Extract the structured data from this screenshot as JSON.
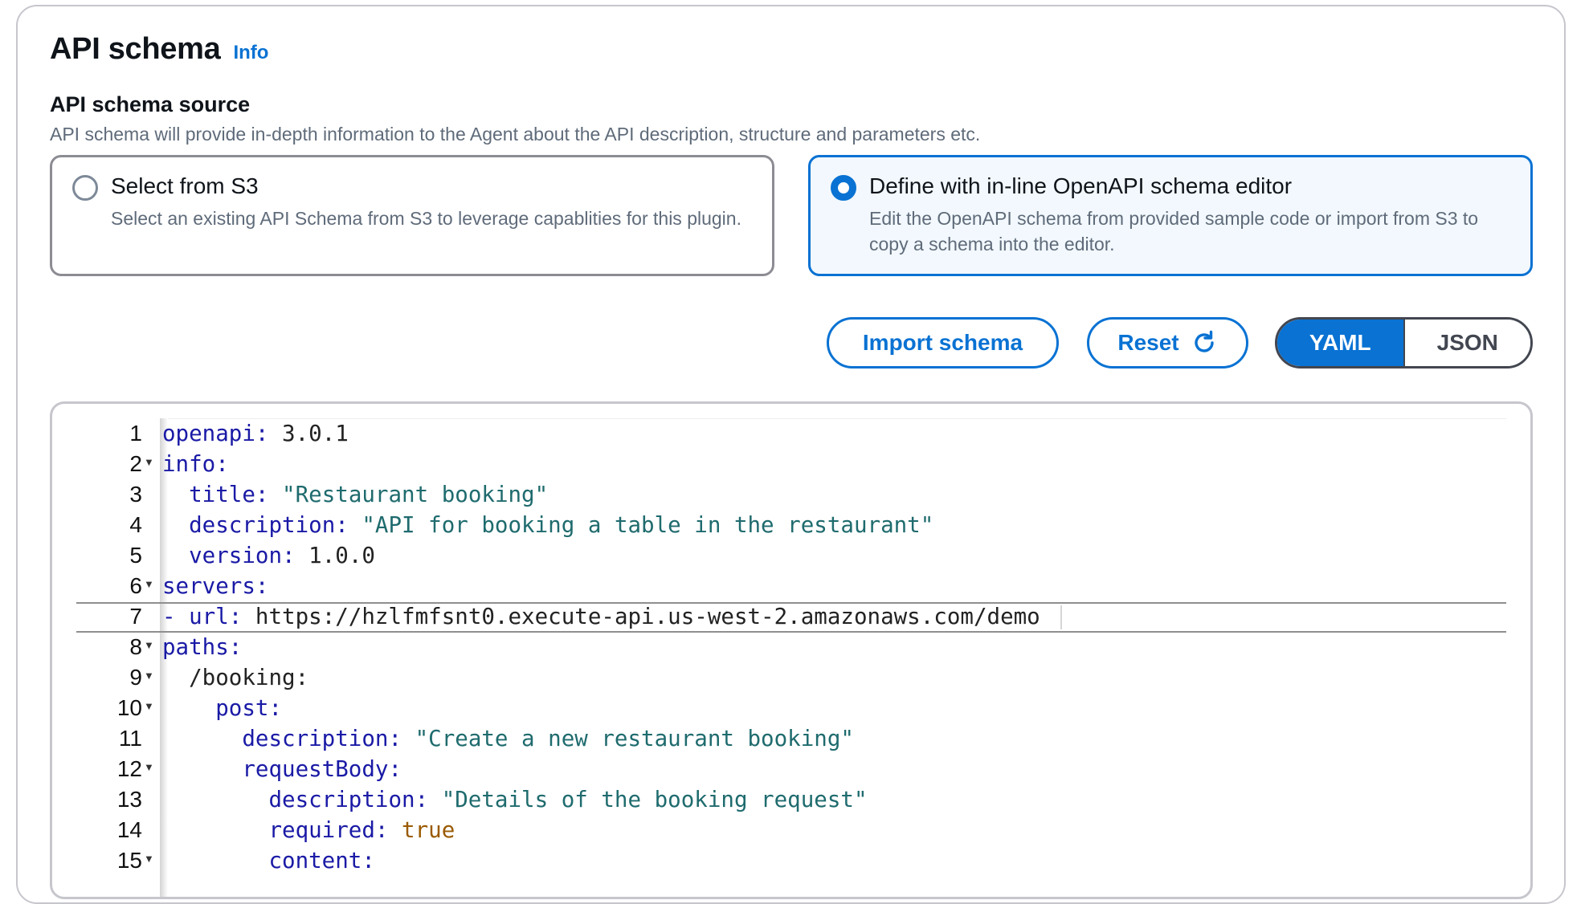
{
  "header": {
    "title": "API schema",
    "info_link": "Info"
  },
  "source": {
    "label": "API schema source",
    "description": "API schema will provide in-depth information to the Agent about the API description, structure and parameters etc.",
    "options": [
      {
        "label": "Select from S3",
        "description": "Select an existing API Schema from S3 to leverage capablities for this plugin.",
        "selected": false
      },
      {
        "label": "Define with in-line OpenAPI schema editor",
        "description": "Edit the OpenAPI schema from provided sample code or import from S3 to copy a schema into the editor.",
        "selected": true
      }
    ]
  },
  "toolbar": {
    "import_label": "Import schema",
    "reset_label": "Reset",
    "format_options": [
      "YAML",
      "JSON"
    ],
    "selected_format": "YAML"
  },
  "editor": {
    "active_line": 7,
    "lines": [
      {
        "n": "1",
        "fold": false,
        "indent": "",
        "key": "openapi",
        "value": "3.0.1",
        "vtype": "n"
      },
      {
        "n": "2",
        "fold": true,
        "indent": "",
        "key": "info",
        "value": "",
        "vtype": ""
      },
      {
        "n": "3",
        "fold": false,
        "indent": "  ",
        "key": "title",
        "value": "\"Restaurant booking\"",
        "vtype": "s"
      },
      {
        "n": "4",
        "fold": false,
        "indent": "  ",
        "key": "description",
        "value": "\"API for booking a table in the restaurant\"",
        "vtype": "s"
      },
      {
        "n": "5",
        "fold": false,
        "indent": "  ",
        "key": "version",
        "value": "1.0.0",
        "vtype": "n"
      },
      {
        "n": "6",
        "fold": true,
        "indent": "",
        "key": "servers",
        "value": "",
        "vtype": ""
      },
      {
        "n": "7",
        "fold": false,
        "indent": "- ",
        "key": "url",
        "value": "https://hzlfmfsnt0.execute-api.us-west-2.amazonaws.com/demo",
        "vtype": "n"
      },
      {
        "n": "8",
        "fold": true,
        "indent": "",
        "key": "paths",
        "value": "",
        "vtype": ""
      },
      {
        "n": "9",
        "fold": true,
        "indent": "  ",
        "key": "/booking",
        "value": "",
        "vtype": "",
        "plainkey": true
      },
      {
        "n": "10",
        "fold": true,
        "indent": "    ",
        "key": "post",
        "value": "",
        "vtype": ""
      },
      {
        "n": "11",
        "fold": false,
        "indent": "      ",
        "key": "description",
        "value": "\"Create a new restaurant booking\"",
        "vtype": "s"
      },
      {
        "n": "12",
        "fold": true,
        "indent": "      ",
        "key": "requestBody",
        "value": "",
        "vtype": ""
      },
      {
        "n": "13",
        "fold": false,
        "indent": "        ",
        "key": "description",
        "value": "\"Details of the booking request\"",
        "vtype": "s"
      },
      {
        "n": "14",
        "fold": false,
        "indent": "        ",
        "key": "required",
        "value": "true",
        "vtype": "b"
      },
      {
        "n": "15",
        "fold": true,
        "indent": "        ",
        "key": "content",
        "value": "",
        "vtype": ""
      }
    ]
  },
  "colors": {
    "accent": "#0972d3",
    "key": "#1a1aa6",
    "string": "#1f6b6e",
    "boolean": "#9a5b00"
  }
}
